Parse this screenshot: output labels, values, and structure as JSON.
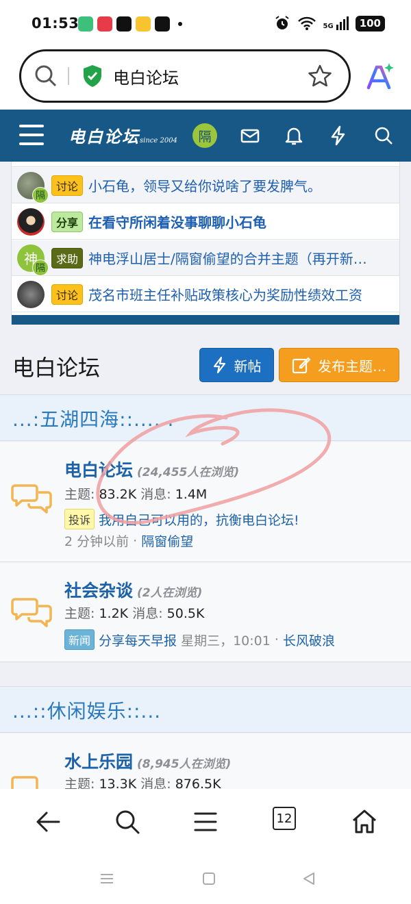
{
  "status_bar": {
    "time": "01:53",
    "network": "5G",
    "battery": "100"
  },
  "browser": {
    "url_text": "电白论坛",
    "tab_count": "12"
  },
  "forum_header": {
    "logo_text": "电白论坛",
    "logo_since": "since 2004",
    "avatar_letter": "隔"
  },
  "threads": [
    {
      "prefix": "讨论",
      "title": "小石龟，领导又给你说啥了要发脾气。",
      "bold": false,
      "avatar_mini": "隔"
    },
    {
      "prefix": "分享",
      "title": "在看守所闲着没事聊聊小石龟",
      "bold": true
    },
    {
      "prefix": "求助",
      "title": "神电浮山居士/隔窗偷望的合并主题（再开新…",
      "bold": false,
      "avatar_letter": "神",
      "avatar_mini": "隔"
    },
    {
      "prefix": "讨论",
      "title": "茂名市班主任补贴政策核心为奖励性绩效工资",
      "bold": false
    }
  ],
  "forum_title": "电白论坛",
  "buttons": {
    "new_posts": "新帖",
    "post_thread": "发布主题…"
  },
  "categories": [
    {
      "title": "...:五湖四海::.... ."
    },
    {
      "title": "...::休闲娱乐::..."
    }
  ],
  "nodes": [
    {
      "name": "电白论坛",
      "viewers": "(24,455人在浏览)",
      "threads_label": "主题:",
      "threads": "83.2K",
      "messages_label": "消息:",
      "messages": "1.4M",
      "latest_prefix": "投诉",
      "latest_title": "我用自己可以用的，抗衡电白论坛!",
      "latest_time": "2 分钟以前",
      "latest_user": "隔窗偷望"
    },
    {
      "name": "社会杂谈",
      "viewers": "(2人在浏览)",
      "threads_label": "主题:",
      "threads": "1.2K",
      "messages_label": "消息:",
      "messages": "50.5K",
      "latest_prefix": "新闻",
      "latest_title": "分享每天早报",
      "latest_time": "星期三，10:01",
      "latest_user": "长风破浪"
    },
    {
      "name": "水上乐园",
      "viewers": "(8,945人在浏览)",
      "threads_label": "主题:",
      "threads": "13.3K",
      "messages_label": "消息:",
      "messages": "876.5K"
    }
  ],
  "colors": {
    "header_blue": "#185886",
    "link_blue": "#1d62a8",
    "accent_orange": "#f49d1e",
    "button_blue": "#1c6fc1"
  }
}
